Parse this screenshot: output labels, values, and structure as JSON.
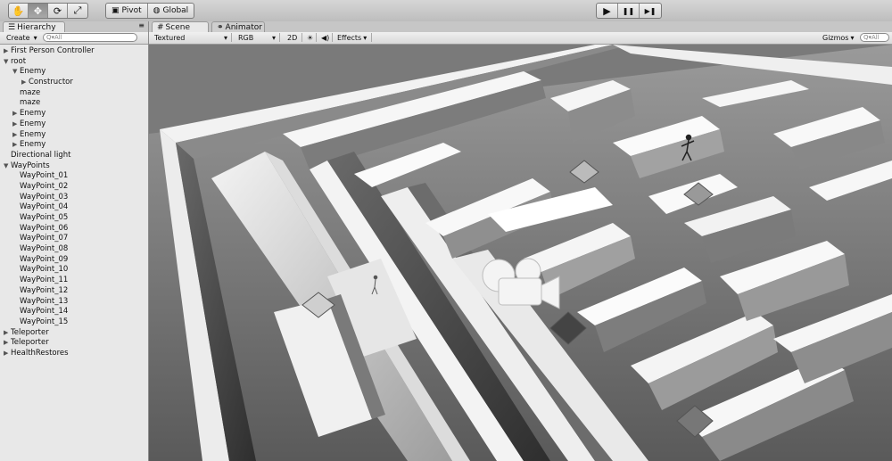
{
  "toolbar": {
    "tools": [
      {
        "icon": "hand-icon",
        "glyph": "✋"
      },
      {
        "icon": "move-icon",
        "glyph": "✥"
      },
      {
        "icon": "rotate-icon",
        "glyph": "⟳"
      },
      {
        "icon": "scale-icon",
        "glyph": "⤢"
      }
    ],
    "pivot_label": "Pivot",
    "global_label": "Global",
    "play_glyph": "▶",
    "pause_glyph": "❚❚",
    "step_glyph": "▶❚"
  },
  "hierarchy": {
    "tab_label": "Hierarchy",
    "create_label": "Create",
    "search_placeholder": "Q▾All",
    "rows": [
      {
        "label": "First Person Controller",
        "depth": 0,
        "arrow": "▶"
      },
      {
        "label": "root",
        "depth": 0,
        "arrow": "▼"
      },
      {
        "label": "Enemy",
        "depth": 1,
        "arrow": "▼"
      },
      {
        "label": "Constructor",
        "depth": 2,
        "arrow": "▶"
      },
      {
        "label": "maze",
        "depth": 1,
        "arrow": ""
      },
      {
        "label": "maze",
        "depth": 1,
        "arrow": ""
      },
      {
        "label": "Enemy",
        "depth": 1,
        "arrow": "▶"
      },
      {
        "label": "Enemy",
        "depth": 1,
        "arrow": "▶"
      },
      {
        "label": "Enemy",
        "depth": 1,
        "arrow": "▶"
      },
      {
        "label": "Enemy",
        "depth": 1,
        "arrow": "▶"
      },
      {
        "label": "Directional light",
        "depth": 0,
        "arrow": ""
      },
      {
        "label": "WayPoints",
        "depth": 0,
        "arrow": "▼"
      },
      {
        "label": "WayPoint_01",
        "depth": 1,
        "arrow": ""
      },
      {
        "label": "WayPoint_02",
        "depth": 1,
        "arrow": ""
      },
      {
        "label": "WayPoint_03",
        "depth": 1,
        "arrow": ""
      },
      {
        "label": "WayPoint_04",
        "depth": 1,
        "arrow": ""
      },
      {
        "label": "WayPoint_05",
        "depth": 1,
        "arrow": ""
      },
      {
        "label": "WayPoint_06",
        "depth": 1,
        "arrow": ""
      },
      {
        "label": "WayPoint_07",
        "depth": 1,
        "arrow": ""
      },
      {
        "label": "WayPoint_08",
        "depth": 1,
        "arrow": ""
      },
      {
        "label": "WayPoint_09",
        "depth": 1,
        "arrow": ""
      },
      {
        "label": "WayPoint_10",
        "depth": 1,
        "arrow": ""
      },
      {
        "label": "WayPoint_11",
        "depth": 1,
        "arrow": ""
      },
      {
        "label": "WayPoint_12",
        "depth": 1,
        "arrow": ""
      },
      {
        "label": "WayPoint_13",
        "depth": 1,
        "arrow": ""
      },
      {
        "label": "WayPoint_14",
        "depth": 1,
        "arrow": ""
      },
      {
        "label": "WayPoint_15",
        "depth": 1,
        "arrow": ""
      },
      {
        "label": "Teleporter",
        "depth": 0,
        "arrow": "▶"
      },
      {
        "label": "Teleporter",
        "depth": 0,
        "arrow": "▶"
      },
      {
        "label": "HealthRestores",
        "depth": 0,
        "arrow": "▶"
      }
    ]
  },
  "scene": {
    "tabs": [
      {
        "label": "Scene",
        "icon": "scene-icon",
        "glyph": "#"
      },
      {
        "label": "Animator",
        "icon": "animator-icon",
        "glyph": "⚭"
      }
    ],
    "render_mode": "Textured",
    "color_mode": "RGB",
    "mode_2d": "2D",
    "lighting_glyph": "☀",
    "audio_glyph": "◀)",
    "effects_label": "Effects",
    "gizmos_label": "Gizmos",
    "gizmo_search_placeholder": "Q▾All"
  }
}
